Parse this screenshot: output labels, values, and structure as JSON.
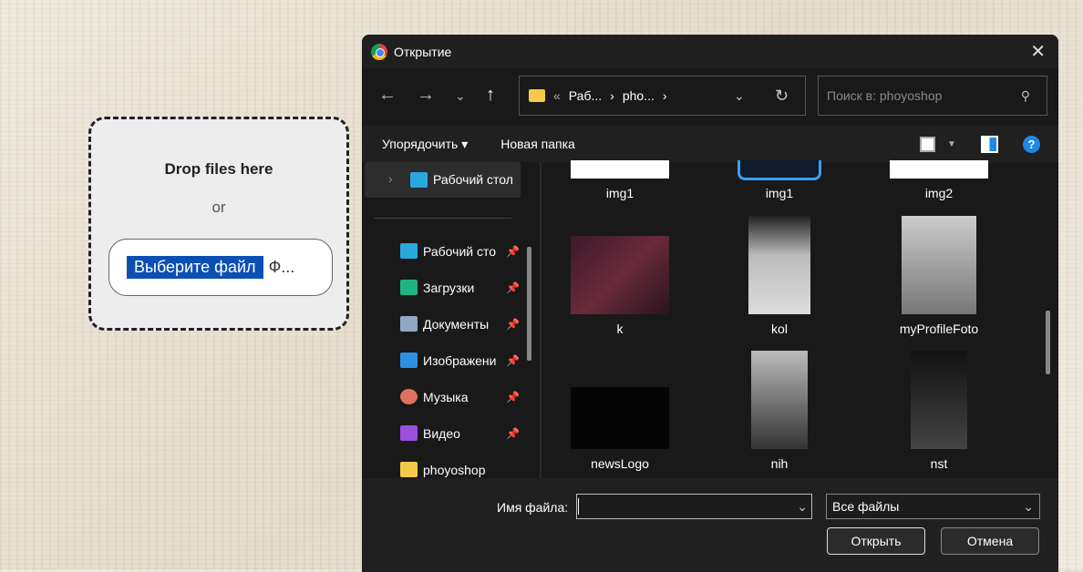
{
  "drop": {
    "title": "Drop files here",
    "or": "or",
    "choose": "Выберите файл",
    "filename": "Ф..."
  },
  "dialog": {
    "title": "Открытие",
    "breadcrumb": [
      "«",
      "Раб...",
      "›",
      "pho...",
      "›"
    ],
    "search_placeholder": "Поиск в: phoyoshop",
    "organize": "Упорядочить ▾",
    "new_folder": "Новая папка",
    "tree_item": "Рабочий стол",
    "quick": [
      {
        "label": "Рабочий сто",
        "color": "#29a8e0"
      },
      {
        "label": "Загрузки",
        "color": "#1db57f"
      },
      {
        "label": "Документы",
        "color": "#8fa8c8"
      },
      {
        "label": "Изображени",
        "color": "#2f8fe0"
      },
      {
        "label": "Музыка",
        "color": "#e07060"
      },
      {
        "label": "Видео",
        "color": "#9b4fe0"
      },
      {
        "label": "phoyoshop",
        "color": "#f6c94a"
      }
    ],
    "files": [
      {
        "name": "img1"
      },
      {
        "name": "img1"
      },
      {
        "name": "img2"
      },
      {
        "name": "k"
      },
      {
        "name": "kol"
      },
      {
        "name": "myProfileFoto"
      },
      {
        "name": "newsLogo"
      },
      {
        "name": "nih"
      },
      {
        "name": "nst"
      }
    ],
    "filename_label": "Имя файла:",
    "filename_value": "",
    "filter": "Все файлы",
    "open": "Открыть",
    "cancel": "Отмена"
  }
}
